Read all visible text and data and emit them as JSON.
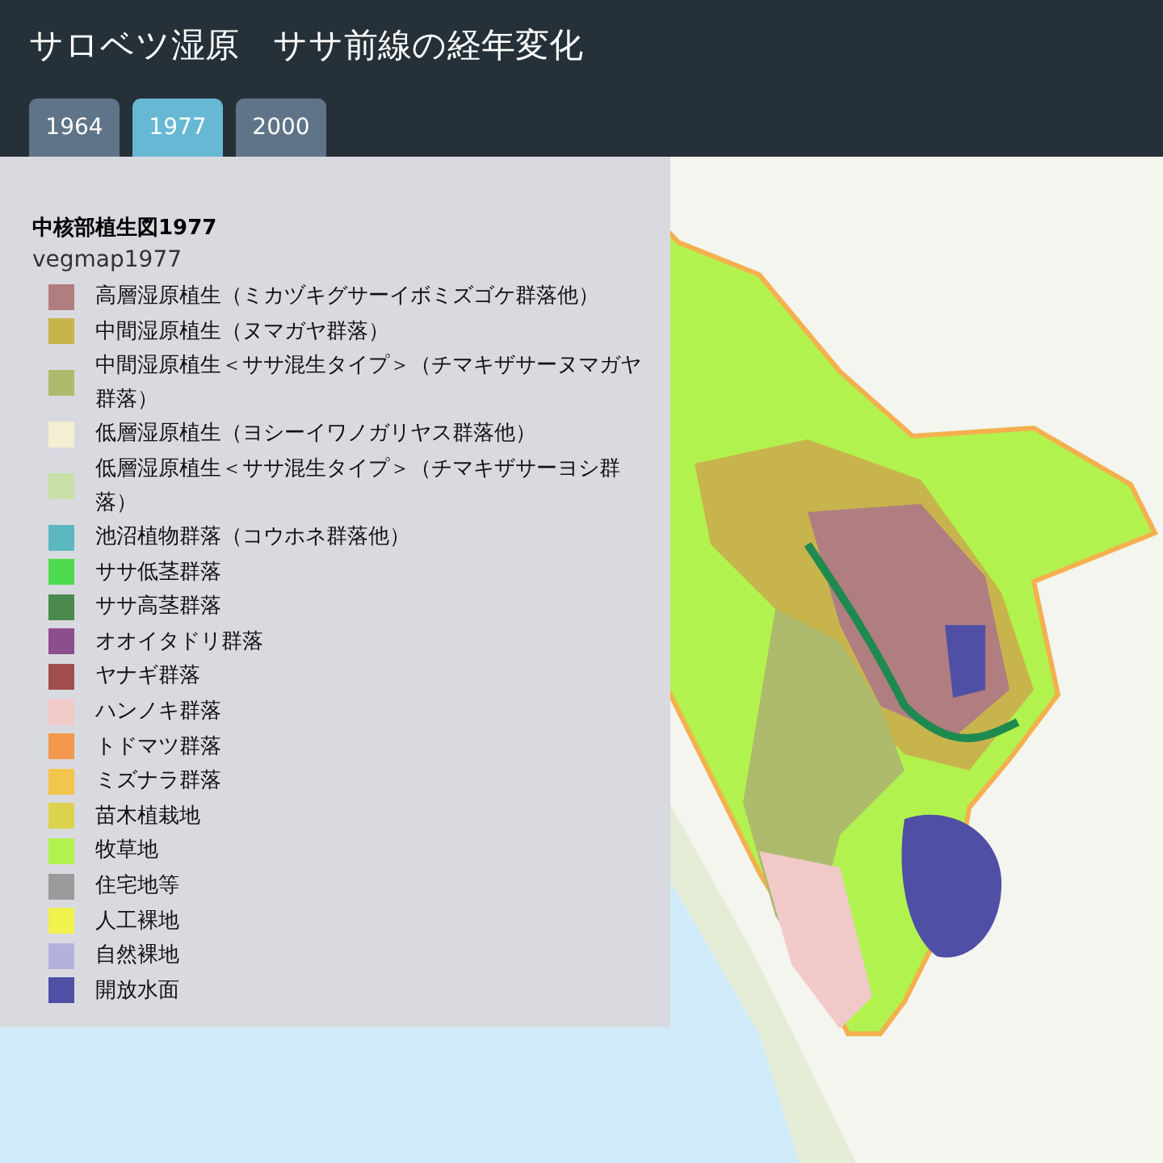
{
  "header": {
    "title": "サロベツ湿原　ササ前線の経年変化"
  },
  "tabs": [
    {
      "label": "1964",
      "selected": false
    },
    {
      "label": "1977",
      "selected": true
    },
    {
      "label": "2000",
      "selected": false
    }
  ],
  "legend": {
    "title": "中核部植生図1977",
    "subtitle": "vegmap1977",
    "items": [
      {
        "label": "高層湿原植生（ミカヅキグサーイボミズゴケ群落他）",
        "color": "#b07e80"
      },
      {
        "label": "中間湿原植生（ヌマガヤ群落）",
        "color": "#c8b44c"
      },
      {
        "label": "中間湿原植生＜ササ混生タイプ＞（チマキザサーヌマガヤ群落）",
        "color": "#aebb6c"
      },
      {
        "label": "低層湿原植生（ヨシーイワノガリヤス群落他）",
        "color": "#f2efd3"
      },
      {
        "label": "低層湿原植生＜ササ混生タイプ＞（チマキザサーヨシ群落）",
        "color": "#c9e0a9"
      },
      {
        "label": "池沼植物群落（コウホネ群落他）",
        "color": "#5cb8c0"
      },
      {
        "label": "ササ低茎群落",
        "color": "#4ddb4d"
      },
      {
        "label": "ササ高茎群落",
        "color": "#4b8a4f"
      },
      {
        "label": "オオイタドリ群落",
        "color": "#8c4e8c"
      },
      {
        "label": "ヤナギ群落",
        "color": "#a04e4e"
      },
      {
        "label": "ハンノキ群落",
        "color": "#f2c9c9"
      },
      {
        "label": "トドマツ群落",
        "color": "#f4984e"
      },
      {
        "label": "ミズナラ群落",
        "color": "#f2c54e"
      },
      {
        "label": "苗木植栽地",
        "color": "#dcd24e"
      },
      {
        "label": "牧草地",
        "color": "#b2f24e"
      },
      {
        "label": "住宅地等",
        "color": "#9b9b9b"
      },
      {
        "label": "人工裸地",
        "color": "#f2f24e"
      },
      {
        "label": "自然裸地",
        "color": "#b2b2dc"
      },
      {
        "label": "開放水面",
        "color": "#4f4fa5"
      }
    ]
  }
}
